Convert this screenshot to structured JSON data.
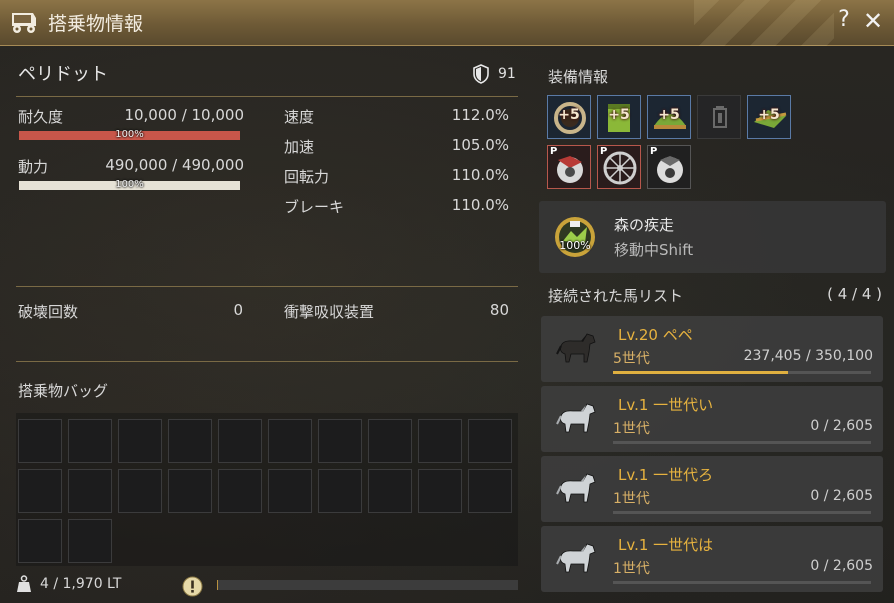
{
  "window": {
    "title": "搭乗物情報",
    "help_label": "?",
    "close_label": "✕",
    "icon": "wagon-icon"
  },
  "vehicle": {
    "name": "ペリドット",
    "defense": "91"
  },
  "stats": {
    "durability_label": "耐久度",
    "durability_value": "10,000 / 10,000",
    "durability_percent": "100%",
    "power_label": "動力",
    "power_value": "490,000 / 490,000",
    "power_percent": "100%",
    "speed_label": "速度",
    "speed_value": "112.0%",
    "accel_label": "加速",
    "accel_value": "105.0%",
    "turn_label": "回転力",
    "turn_value": "110.0%",
    "brake_label": "ブレーキ",
    "brake_value": "110.0%",
    "destroy_label": "破壊回数",
    "destroy_value": "0",
    "shock_label": "衝撃吸収装置",
    "shock_value": "80"
  },
  "bag": {
    "label": "搭乗物バッグ",
    "weight": "4 / 1,970 LT",
    "weight_fraction": 0.002
  },
  "equipment": {
    "label": "装備情報",
    "enhance_label": "+5",
    "p_label": "P"
  },
  "skill": {
    "name": "森の疾走",
    "description": "移動中Shift",
    "percent": "100%"
  },
  "horses": {
    "label": "接続された馬リスト",
    "count": "( 4 / 4 )",
    "items": [
      {
        "level": "Lv.20 ペペ",
        "generation": "5世代",
        "exp": "237,405 / 350,100",
        "fraction": 0.678,
        "color": "dark"
      },
      {
        "level": "Lv.1 一世代い",
        "generation": "1世代",
        "exp": "0 / 2,605",
        "fraction": 0.0,
        "color": "white"
      },
      {
        "level": "Lv.1 一世代ろ",
        "generation": "1世代",
        "exp": "0 / 2,605",
        "fraction": 0.0,
        "color": "white"
      },
      {
        "level": "Lv.1 一世代は",
        "generation": "1世代",
        "exp": "0 / 2,605",
        "fraction": 0.0,
        "color": "white"
      }
    ]
  },
  "colors": {
    "durability_bar": "#c8564a",
    "power_bar": "#e6e2d6",
    "accent_gold": "#e6b23f"
  }
}
